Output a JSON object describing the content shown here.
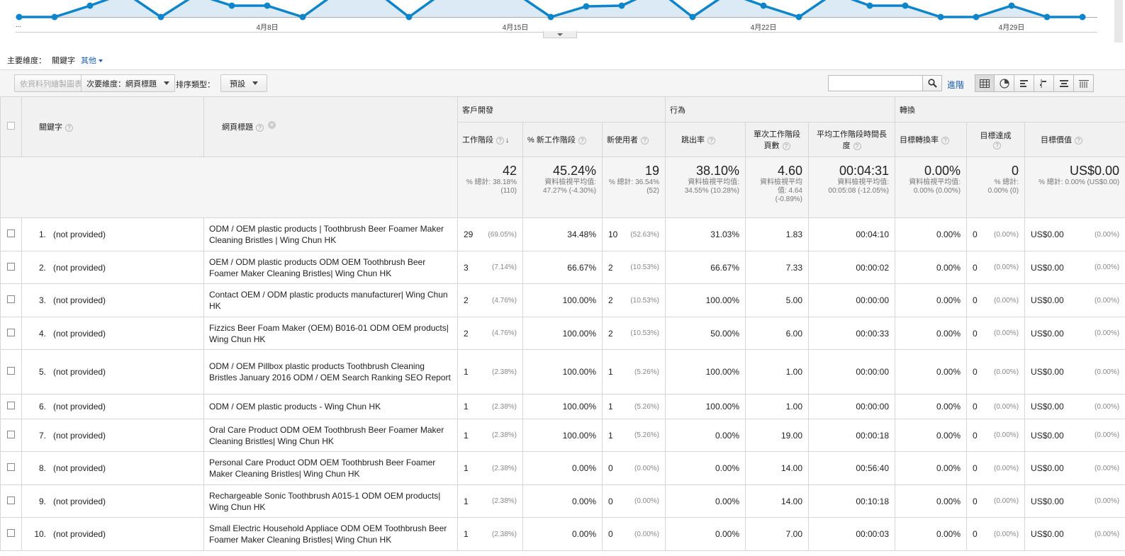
{
  "chart": {
    "x_labels": [
      "...",
      "4月8日",
      "4月15日",
      "4月22日",
      "4月29日"
    ],
    "colors": {
      "line": "#0f85c9",
      "fill": "#dbeaf5"
    }
  },
  "dimension": {
    "label": "主要維度：",
    "active": "關鍵字",
    "other": "其他"
  },
  "toolbar": {
    "plot_rows": "依資料列繪製圖表",
    "secondary": "次要維度：網頁標題",
    "sort_label": "排序類型：",
    "sort_value": "預設",
    "search_value": "",
    "advanced": "進階",
    "view_icons": [
      "table-view-icon",
      "pie-view-icon",
      "performance-view-icon",
      "compare-view-icon",
      "term-cloud-icon",
      "pivot-view-icon"
    ]
  },
  "table": {
    "group_headers": {
      "acquisition": "客戶開發",
      "behavior": "行為",
      "conversions": "轉換"
    },
    "columns": {
      "keyword": "關鍵字",
      "page_title": "網頁標題",
      "sessions": "工作階段",
      "new_sessions_pct": "% 新工作階段",
      "new_users": "新使用者",
      "bounce_rate": "跳出率",
      "pages_per_session": "單次工作階段頁數",
      "avg_duration": "平均工作階段時間長度",
      "goal_conv_rate": "目標轉換率",
      "goal_completions": "目標達成",
      "goal_value": "目標價值"
    },
    "totals": {
      "sessions": "42",
      "sessions_sub": "% 總計: 38.18% (110)",
      "new_sessions_pct": "45.24%",
      "new_sessions_pct_sub": "資料檢視平均值: 47.27% (-4.30%)",
      "new_users": "19",
      "new_users_sub": "% 總計: 36.54% (52)",
      "bounce_rate": "38.10%",
      "bounce_rate_sub": "資料檢視平均值: 34.55% (10.28%)",
      "pages_per_session": "4.60",
      "pages_per_session_sub": "資料檢視平均值: 4.64 (-0.89%)",
      "avg_duration": "00:04:31",
      "avg_duration_sub": "資料檢視平均值: 00:05:08 (-12.05%)",
      "goal_conv_rate": "0.00%",
      "goal_conv_rate_sub": "資料檢視平均值: 0.00% (0.00%)",
      "goal_completions": "0",
      "goal_completions_sub": "% 總計: 0.00% (0)",
      "goal_value": "US$0.00",
      "goal_value_sub": "% 總計: 0.00% (US$0.00)"
    },
    "rows": [
      {
        "idx": "1.",
        "keyword": "(not provided)",
        "title": "ODM / OEM plastic products | Toothbrush Beer Foamer Maker Cleaning Bristles | Wing Chun HK",
        "sessions": "29",
        "sessions_pct": "(69.05%)",
        "new_pct": "34.48%",
        "new_users": "10",
        "new_users_pct": "(52.63%)",
        "bounce": "31.03%",
        "pages": "1.83",
        "duration": "00:04:10",
        "conv": "0.00%",
        "goals": "0",
        "goals_pct": "(0.00%)",
        "value": "US$0.00",
        "value_pct": "(0.00%)"
      },
      {
        "idx": "2.",
        "keyword": "(not provided)",
        "title": "OEM / ODM plastic products ODM OEM Toothbrush Beer Foamer Maker Cleaning Bristles| Wing Chun HK",
        "sessions": "3",
        "sessions_pct": "(7.14%)",
        "new_pct": "66.67%",
        "new_users": "2",
        "new_users_pct": "(10.53%)",
        "bounce": "66.67%",
        "pages": "7.33",
        "duration": "00:00:02",
        "conv": "0.00%",
        "goals": "0",
        "goals_pct": "(0.00%)",
        "value": "US$0.00",
        "value_pct": "(0.00%)"
      },
      {
        "idx": "3.",
        "keyword": "(not provided)",
        "title": "Contact OEM / ODM plastic products manufacturer| Wing Chun HK",
        "sessions": "2",
        "sessions_pct": "(4.76%)",
        "new_pct": "100.00%",
        "new_users": "2",
        "new_users_pct": "(10.53%)",
        "bounce": "100.00%",
        "pages": "5.00",
        "duration": "00:00:00",
        "conv": "0.00%",
        "goals": "0",
        "goals_pct": "(0.00%)",
        "value": "US$0.00",
        "value_pct": "(0.00%)"
      },
      {
        "idx": "4.",
        "keyword": "(not provided)",
        "title": "Fizzics Beer Foam Maker (OEM) B016-01 ODM OEM products| Wing Chun HK",
        "sessions": "2",
        "sessions_pct": "(4.76%)",
        "new_pct": "100.00%",
        "new_users": "2",
        "new_users_pct": "(10.53%)",
        "bounce": "50.00%",
        "pages": "6.00",
        "duration": "00:00:33",
        "conv": "0.00%",
        "goals": "0",
        "goals_pct": "(0.00%)",
        "value": "US$0.00",
        "value_pct": "(0.00%)"
      },
      {
        "idx": "5.",
        "keyword": "(not provided)",
        "title": "ODM / OEM Pillbox plastic products Toothbrush Cleaning Bristles January 2016 ODM / OEM Search Ranking SEO Report",
        "sessions": "1",
        "sessions_pct": "(2.38%)",
        "new_pct": "100.00%",
        "new_users": "1",
        "new_users_pct": "(5.26%)",
        "bounce": "100.00%",
        "pages": "1.00",
        "duration": "00:00:00",
        "conv": "0.00%",
        "goals": "0",
        "goals_pct": "(0.00%)",
        "value": "US$0.00",
        "value_pct": "(0.00%)"
      },
      {
        "idx": "6.",
        "keyword": "(not provided)",
        "title": "ODM / OEM plastic products - Wing Chun HK",
        "sessions": "1",
        "sessions_pct": "(2.38%)",
        "new_pct": "100.00%",
        "new_users": "1",
        "new_users_pct": "(5.26%)",
        "bounce": "100.00%",
        "pages": "1.00",
        "duration": "00:00:00",
        "conv": "0.00%",
        "goals": "0",
        "goals_pct": "(0.00%)",
        "value": "US$0.00",
        "value_pct": "(0.00%)"
      },
      {
        "idx": "7.",
        "keyword": "(not provided)",
        "title": "Oral Care Product ODM OEM Toothbrush Beer Foamer Maker Cleaning Bristles| Wing Chun HK",
        "sessions": "1",
        "sessions_pct": "(2.38%)",
        "new_pct": "100.00%",
        "new_users": "1",
        "new_users_pct": "(5.26%)",
        "bounce": "0.00%",
        "pages": "19.00",
        "duration": "00:00:18",
        "conv": "0.00%",
        "goals": "0",
        "goals_pct": "(0.00%)",
        "value": "US$0.00",
        "value_pct": "(0.00%)"
      },
      {
        "idx": "8.",
        "keyword": "(not provided)",
        "title": "Personal Care Product ODM OEM Toothbrush Beer Foamer Maker Cleaning Bristles| Wing Chun HK",
        "sessions": "1",
        "sessions_pct": "(2.38%)",
        "new_pct": "0.00%",
        "new_users": "0",
        "new_users_pct": "(0.00%)",
        "bounce": "0.00%",
        "pages": "14.00",
        "duration": "00:56:40",
        "conv": "0.00%",
        "goals": "0",
        "goals_pct": "(0.00%)",
        "value": "US$0.00",
        "value_pct": "(0.00%)"
      },
      {
        "idx": "9.",
        "keyword": "(not provided)",
        "title": "Rechargeable Sonic Toothbrush A015-1 ODM OEM products| Wing Chun HK",
        "sessions": "1",
        "sessions_pct": "(2.38%)",
        "new_pct": "0.00%",
        "new_users": "0",
        "new_users_pct": "(0.00%)",
        "bounce": "0.00%",
        "pages": "14.00",
        "duration": "00:10:18",
        "conv": "0.00%",
        "goals": "0",
        "goals_pct": "(0.00%)",
        "value": "US$0.00",
        "value_pct": "(0.00%)"
      },
      {
        "idx": "10.",
        "keyword": "(not provided)",
        "title": "Small Electric Household Appliace ODM OEM Toothbrush Beer Foamer Maker Cleaning Bristles| Wing Chun HK",
        "sessions": "1",
        "sessions_pct": "(2.38%)",
        "new_pct": "0.00%",
        "new_users": "0",
        "new_users_pct": "(0.00%)",
        "bounce": "0.00%",
        "pages": "7.00",
        "duration": "00:00:03",
        "conv": "0.00%",
        "goals": "0",
        "goals_pct": "(0.00%)",
        "value": "US$0.00",
        "value_pct": "(0.00%)"
      }
    ]
  }
}
